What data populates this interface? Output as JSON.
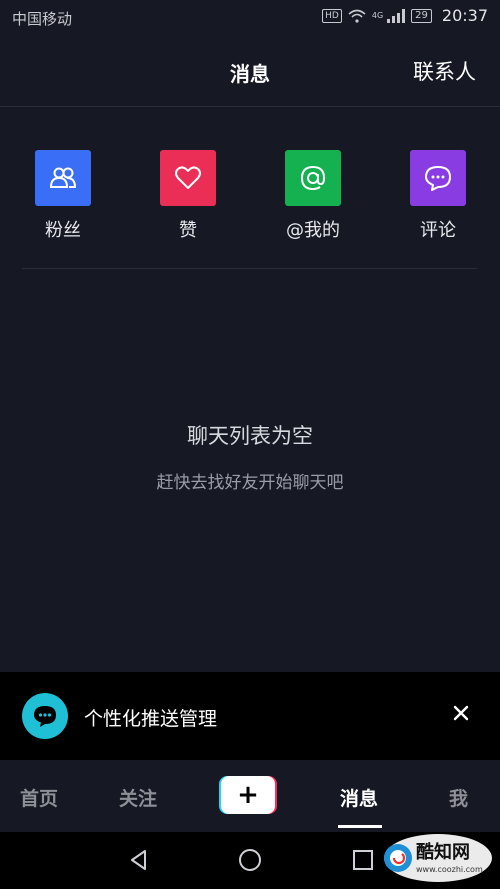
{
  "status": {
    "carrier": "中国移动",
    "hd": "HD",
    "network": "4G",
    "battery": "29",
    "time": "20:37"
  },
  "header": {
    "title": "消息",
    "contacts": "联系人"
  },
  "quick_actions": [
    {
      "label": "粉丝",
      "icon": "fans-icon",
      "color": "#3b6ef6"
    },
    {
      "label": "赞",
      "icon": "heart-icon",
      "color": "#ea2e55"
    },
    {
      "label": "@我的",
      "icon": "at-icon",
      "color": "#15b050"
    },
    {
      "label": "评论",
      "icon": "comment-icon",
      "color": "#8a3ce3"
    }
  ],
  "empty": {
    "title": "聊天列表为空",
    "subtitle": "赶快去找好友开始聊天吧"
  },
  "push_banner": {
    "text": "个性化推送管理"
  },
  "tabs": {
    "home": "首页",
    "follow": "关注",
    "plus": "+",
    "messages": "消息",
    "me": "我"
  },
  "watermark": {
    "brand": "酷知网",
    "url": "www.coozhi.com"
  }
}
